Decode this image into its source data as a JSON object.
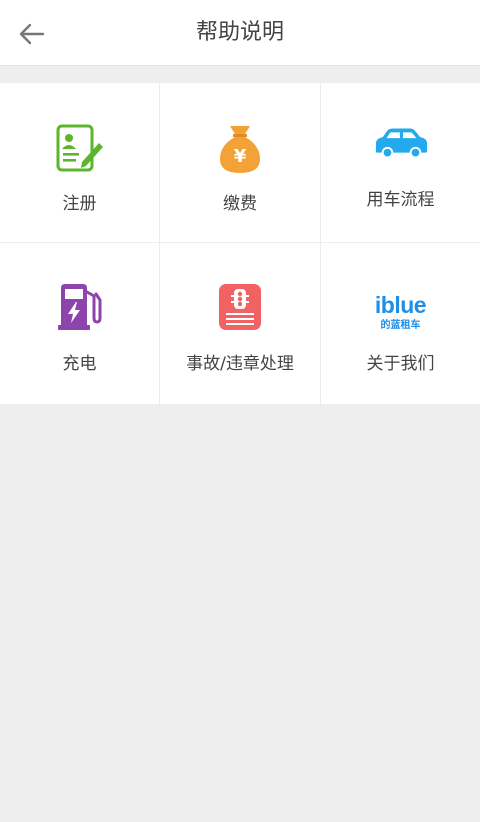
{
  "header": {
    "title": "帮助说明",
    "back_icon": "arrow-left-icon"
  },
  "colors": {
    "register_green": "#5bb52d",
    "payment_orange": "#f2a236",
    "car_blue": "#22a9ee",
    "charge_purple": "#8e44ad",
    "accident_red": "#f06264",
    "brand_blue": "#1f8fe6"
  },
  "menu": {
    "items": [
      {
        "label": "注册",
        "icon": "document-pen-icon"
      },
      {
        "label": "缴费",
        "icon": "money-bag-icon"
      },
      {
        "label": "用车流程",
        "icon": "car-icon"
      },
      {
        "label": "充电",
        "icon": "charging-station-icon"
      },
      {
        "label": "事故/违章处理",
        "icon": "traffic-light-icon"
      },
      {
        "label": "关于我们",
        "icon": "iblue-logo-icon",
        "logo_text": "iblue",
        "logo_sub": "的蓝租车"
      }
    ]
  }
}
